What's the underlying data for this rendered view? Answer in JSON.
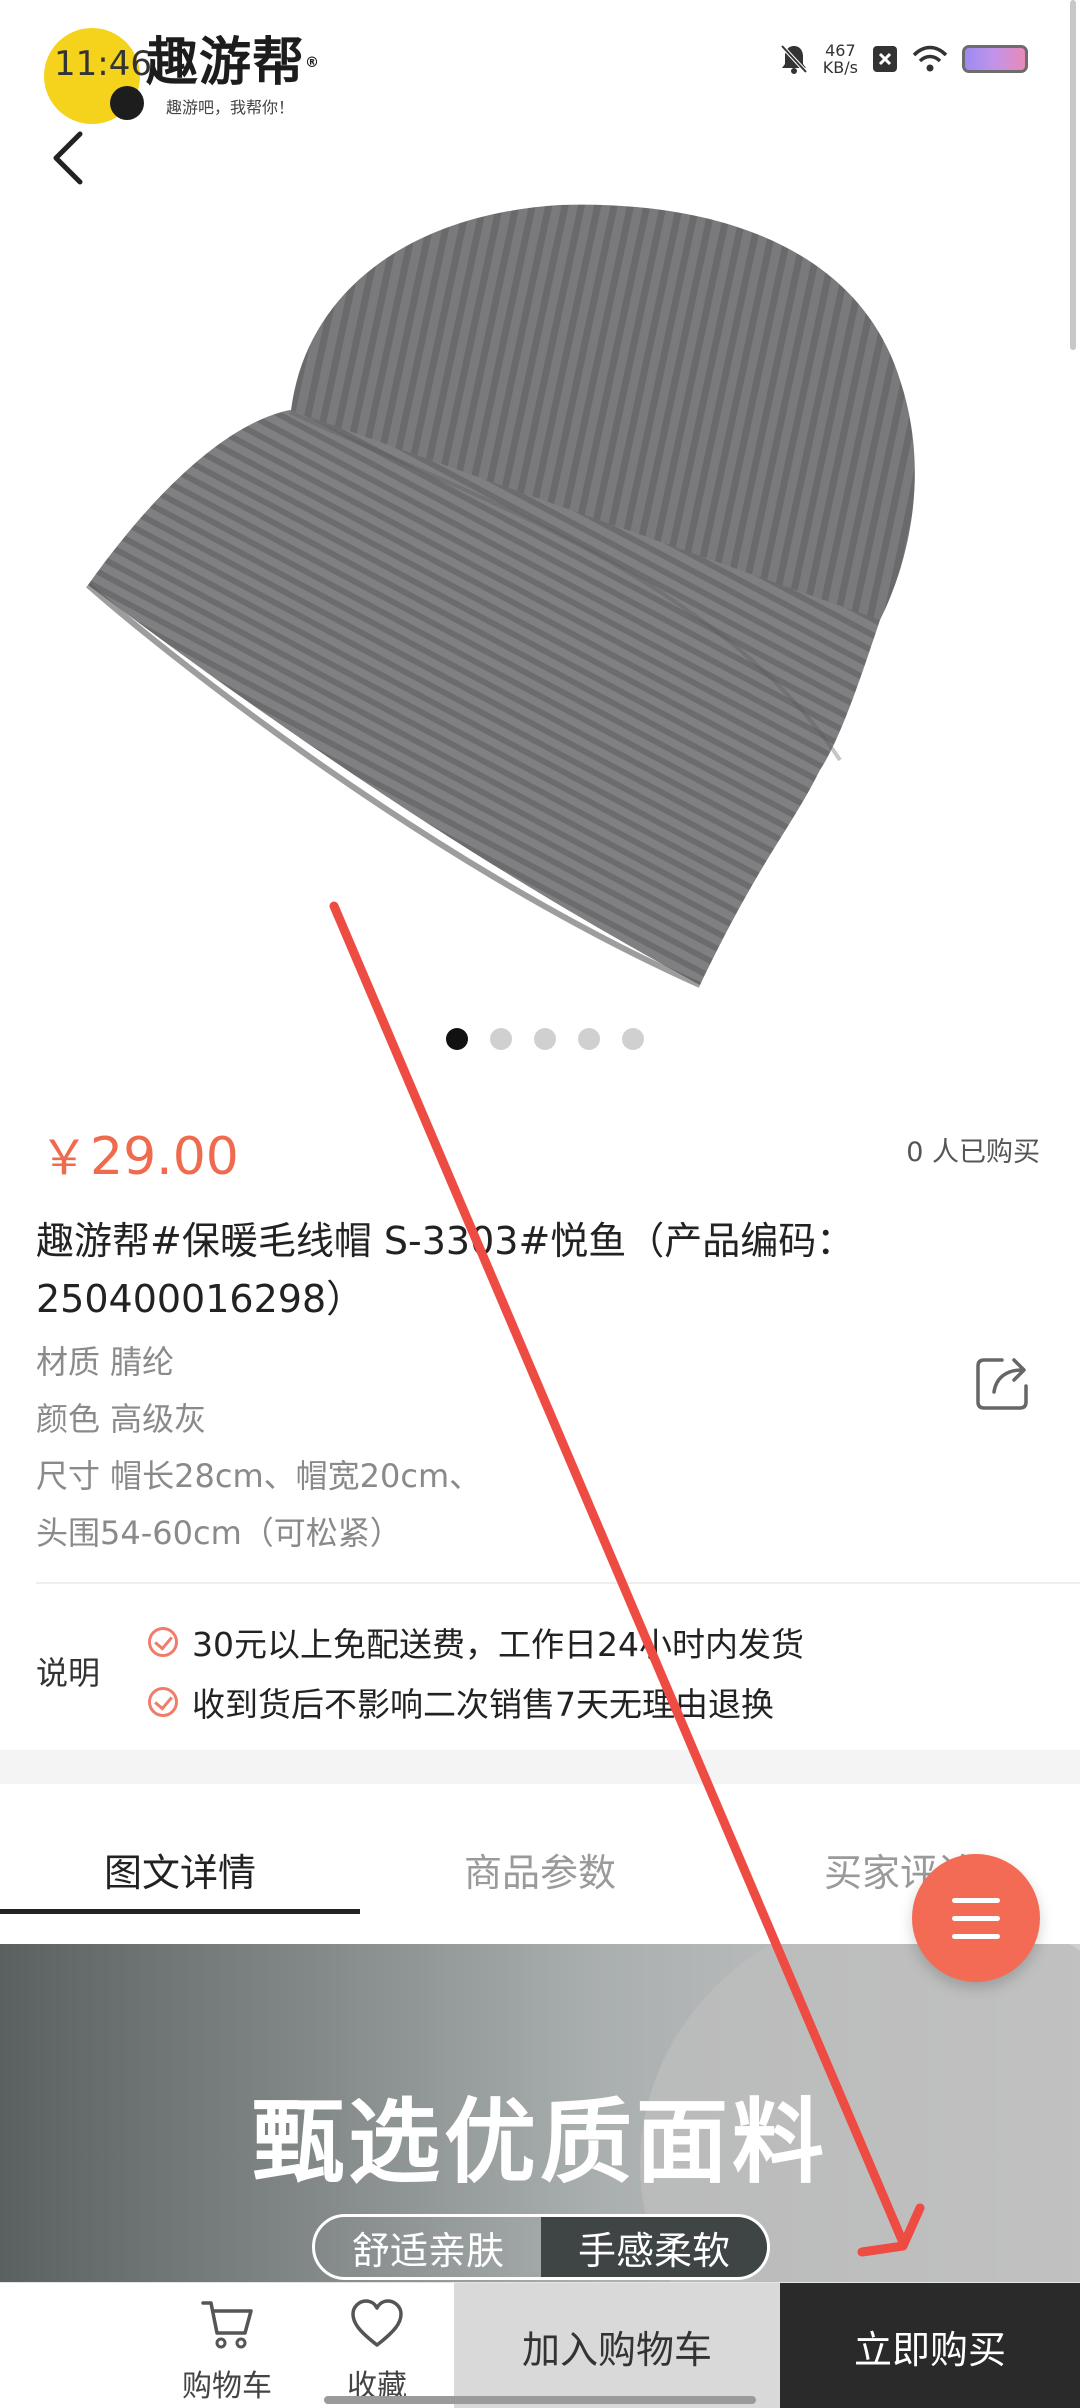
{
  "status_bar": {
    "time": "11:46",
    "net_speed_value": "467",
    "net_speed_unit": "KB/s"
  },
  "logo": {
    "title": "趣游帮",
    "registered": "®",
    "slogan": "趣游吧，我帮你！"
  },
  "gallery": {
    "image_count": 5,
    "active_index": 0
  },
  "product": {
    "price_symbol": "￥",
    "price": "29.00",
    "sold": "0 人已购买",
    "title": "趣游帮#保暖毛线帽 S-3303#悦鱼（产品编码：250400016298）",
    "specs": [
      "材质 腈纶",
      "颜色 高级灰",
      "尺寸 帽长28cm、帽宽20cm、",
      "头围54-60cm（可松紧）"
    ]
  },
  "description": {
    "label": "说明",
    "items": [
      "30元以上免配送费，工作日24小时内发货",
      "收到货后不影响二次销售7天无理由退换"
    ]
  },
  "tabs": [
    "图文详情",
    "商品参数",
    "买家评论"
  ],
  "active_tab": 0,
  "banner": {
    "title": "甄选优质面料",
    "tags": [
      "舒适亲肤",
      "手感柔软"
    ]
  },
  "bottom_bar": {
    "cart": "购物车",
    "favorite": "收藏",
    "add_to_cart": "加入购物车",
    "buy_now": "立即购买"
  },
  "colors": {
    "accent": "#f06a4d",
    "fab": "#f36a55",
    "buy_bg": "#2a2a2a",
    "annotation_arrow": "#ee4b43"
  }
}
